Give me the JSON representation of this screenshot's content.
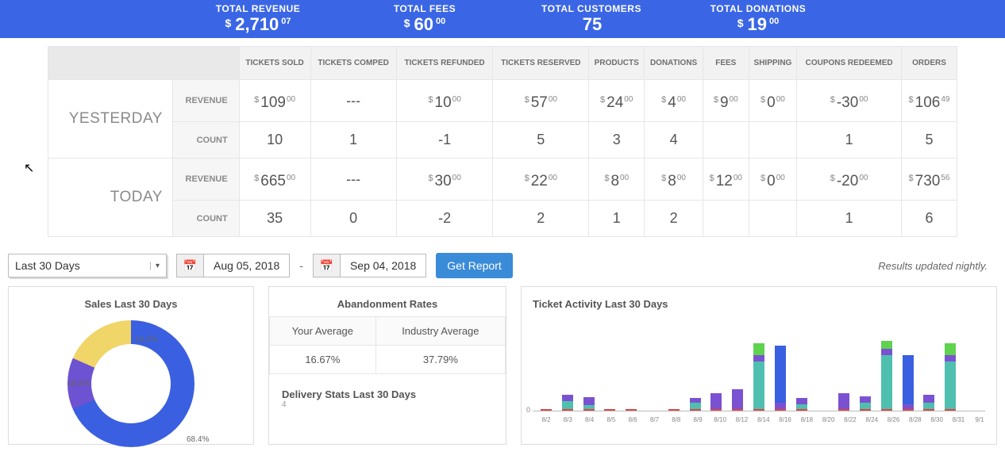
{
  "summary_bar": [
    {
      "label": "TOTAL REVENUE",
      "symbol": "$",
      "whole": "2,710",
      "cents": "07"
    },
    {
      "label": "TOTAL FEES",
      "symbol": "$",
      "whole": "60",
      "cents": "00"
    },
    {
      "label": "TOTAL CUSTOMERS",
      "symbol": "",
      "whole": "75",
      "cents": ""
    },
    {
      "label": "TOTAL DONATIONS",
      "symbol": "$",
      "whole": "19",
      "cents": "00"
    }
  ],
  "table": {
    "columns": [
      "TICKETS SOLD",
      "TICKETS COMPED",
      "TICKETS REFUNDED",
      "TICKETS RESERVED",
      "PRODUCTS",
      "DONATIONS",
      "FEES",
      "SHIPPING",
      "COUPONS REDEEMED",
      "ORDERS"
    ],
    "row_sublabels": {
      "revenue": "REVENUE",
      "count": "COUNT"
    },
    "sections": [
      {
        "name": "YESTERDAY",
        "revenue": [
          {
            "whole": "109",
            "cents": "00"
          },
          {
            "text": "---"
          },
          {
            "whole": "10",
            "cents": "00"
          },
          {
            "whole": "57",
            "cents": "00"
          },
          {
            "whole": "24",
            "cents": "00"
          },
          {
            "whole": "4",
            "cents": "00"
          },
          {
            "whole": "9",
            "cents": "00"
          },
          {
            "whole": "0",
            "cents": "00"
          },
          {
            "whole": "-30",
            "cents": "00"
          },
          {
            "whole": "106",
            "cents": "49"
          }
        ],
        "count": [
          "10",
          "1",
          "-1",
          "5",
          "3",
          "4",
          "",
          "",
          "1",
          "5"
        ]
      },
      {
        "name": "TODAY",
        "revenue": [
          {
            "whole": "665",
            "cents": "00"
          },
          {
            "text": "---"
          },
          {
            "whole": "30",
            "cents": "00"
          },
          {
            "whole": "22",
            "cents": "00"
          },
          {
            "whole": "8",
            "cents": "00"
          },
          {
            "whole": "8",
            "cents": "00"
          },
          {
            "whole": "12",
            "cents": "00"
          },
          {
            "whole": "0",
            "cents": "00"
          },
          {
            "whole": "-20",
            "cents": "00"
          },
          {
            "whole": "730",
            "cents": "56"
          }
        ],
        "count": [
          "35",
          "0",
          "-2",
          "2",
          "1",
          "2",
          "",
          "",
          "1",
          "6"
        ]
      }
    ]
  },
  "filters": {
    "range_preset": "Last 30 Days",
    "date_from": "Aug 05, 2018",
    "date_to": "Sep 04, 2018",
    "button": "Get Report",
    "note": "Results updated nightly."
  },
  "panels": {
    "sales": {
      "title": "Sales Last 30 Days",
      "slices": [
        {
          "label": "68.4%",
          "value": 68.4,
          "color": "#3a5fe0"
        },
        {
          "label": "13.2%",
          "value": 13.2,
          "color": "#6d52d1"
        },
        {
          "label": "18.4%",
          "value": 18.4,
          "color": "#f0d568"
        }
      ]
    },
    "abandon": {
      "title": "Abandonment Rates",
      "headers": [
        "Your Average",
        "Industry Average"
      ],
      "values": [
        "16.67%",
        "37.79%"
      ],
      "delivery_title": "Delivery Stats Last 30 Days",
      "delivery_sub": "4"
    },
    "activity": {
      "title": "Ticket Activity Last 30 Days",
      "ylabel_zero": "0",
      "xlabels": [
        "8/2",
        "8/3",
        "8/4",
        "8/5",
        "8/6",
        "8/7",
        "8/8",
        "8/9",
        "8/10",
        "8/12",
        "8/14",
        "8/16",
        "8/18",
        "8/20",
        "8/22",
        "8/24",
        "8/26",
        "8/28",
        "8/30",
        "8/31",
        "9/1"
      ]
    }
  },
  "chart_data": [
    {
      "type": "pie",
      "title": "Sales Last 30 Days",
      "series": [
        {
          "name": "blue",
          "value": 68.4
        },
        {
          "name": "purple",
          "value": 13.2
        },
        {
          "name": "yellow",
          "value": 18.4
        }
      ]
    },
    {
      "type": "table",
      "title": "Abandonment Rates",
      "categories": [
        "Your Average",
        "Industry Average"
      ],
      "values": [
        16.67,
        37.79
      ]
    },
    {
      "type": "bar",
      "title": "Ticket Activity Last 30 Days",
      "xlabel": "",
      "ylabel": "",
      "ylim": [
        0,
        100
      ],
      "x": [
        "8/2",
        "8/3",
        "8/4",
        "8/5",
        "8/6",
        "8/7",
        "8/8",
        "8/9",
        "8/10",
        "8/12",
        "8/14",
        "8/16",
        "8/18",
        "8/20",
        "8/22",
        "8/24",
        "8/26",
        "8/28",
        "8/30",
        "8/31",
        "9/1"
      ],
      "series": [
        {
          "name": "red",
          "values": [
            2,
            2,
            2,
            2,
            2,
            0,
            2,
            2,
            2,
            2,
            2,
            2,
            2,
            0,
            2,
            2,
            2,
            2,
            2,
            2,
            0
          ]
        },
        {
          "name": "teal",
          "values": [
            0,
            10,
            5,
            0,
            0,
            0,
            0,
            8,
            0,
            0,
            60,
            0,
            6,
            0,
            0,
            8,
            68,
            0,
            8,
            60,
            0
          ]
        },
        {
          "name": "purple",
          "values": [
            0,
            8,
            10,
            0,
            0,
            0,
            0,
            6,
            20,
            25,
            8,
            8,
            8,
            0,
            20,
            8,
            8,
            6,
            10,
            8,
            0
          ]
        },
        {
          "name": "blue",
          "values": [
            0,
            0,
            0,
            0,
            0,
            0,
            0,
            0,
            0,
            0,
            0,
            72,
            0,
            0,
            0,
            0,
            0,
            62,
            0,
            0,
            0
          ]
        },
        {
          "name": "green",
          "values": [
            0,
            0,
            0,
            0,
            0,
            0,
            0,
            0,
            0,
            0,
            15,
            0,
            0,
            0,
            0,
            0,
            10,
            0,
            0,
            15,
            0
          ]
        }
      ]
    }
  ]
}
